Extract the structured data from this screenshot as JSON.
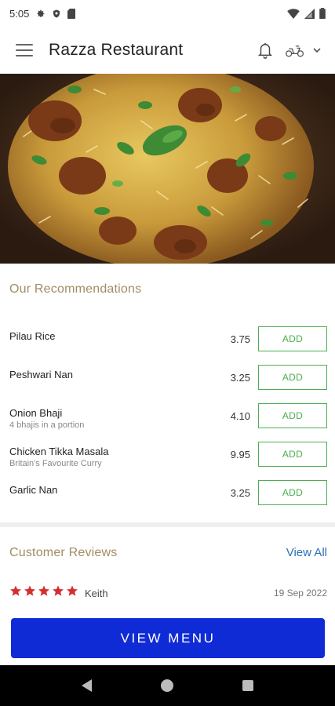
{
  "status_bar": {
    "time": "5:05",
    "icons": [
      "gear-icon",
      "shield-icon",
      "sim-card-icon",
      "wifi-icon",
      "signal-icon",
      "battery-icon"
    ]
  },
  "app_bar": {
    "title": "Razza Restaurant",
    "icons": [
      "menu-icon",
      "bell-icon",
      "scooter-icon",
      "chevron-down-icon"
    ]
  },
  "hero": {
    "image": "biryani-dish-photo"
  },
  "recommendations": {
    "title": "Our Recommendations",
    "add_label": "ADD",
    "items": [
      {
        "name": "Pilau Rice",
        "desc": "",
        "price": "3.75"
      },
      {
        "name": "Peshwari Nan",
        "desc": "",
        "price": "3.25"
      },
      {
        "name": "Onion Bhaji",
        "desc": "4 bhajis in a portion",
        "price": "4.10"
      },
      {
        "name": "Chicken Tikka Masala",
        "desc": "Britain's Favourite Curry",
        "price": "9.95"
      },
      {
        "name": "Garlic Nan",
        "desc": "",
        "price": "3.25"
      }
    ]
  },
  "reviews": {
    "title": "Customer Reviews",
    "view_all": "View All",
    "items": [
      {
        "rating": 5,
        "name": "Keith",
        "date": "19 Sep 2022"
      }
    ]
  },
  "cta": {
    "view_menu": "VIEW MENU"
  },
  "colors": {
    "accent_gold": "#a08d62",
    "add_green": "#4caf50",
    "cta_blue": "#0f2bd6",
    "link_blue": "#2a6fb5",
    "star_red": "#d32f2f"
  }
}
